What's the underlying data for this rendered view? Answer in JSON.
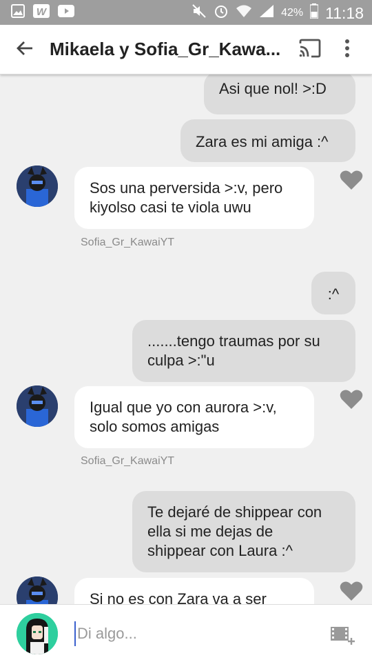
{
  "status_bar": {
    "battery_percent": "42%",
    "time": "11:18",
    "icons": [
      "gallery-icon",
      "w-app-icon",
      "youtube-icon",
      "mute-icon",
      "alarm-icon",
      "wifi-icon",
      "signal-icon",
      "battery-icon"
    ]
  },
  "app_bar": {
    "title": "Mikaela y Sofia_Gr_Kawa...",
    "back_icon": "arrow-back-icon",
    "cast_icon": "cast-icon",
    "more_icon": "more-vertical-icon"
  },
  "messages": [
    {
      "direction": "out",
      "text": "Asi que nol!  >:D"
    },
    {
      "direction": "out",
      "text": "Zara es mi amiga :^"
    },
    {
      "direction": "in",
      "text": "Sos una perversida >:v, pero\nkiyolso casi te viola uwu",
      "sender": "Sofia_Gr_KawaiYT"
    },
    {
      "direction": "out",
      "text": ":^"
    },
    {
      "direction": "out",
      "text": ".......tengo traumas por su\nculpa >:\"u"
    },
    {
      "direction": "in",
      "text": "Igual que yo con aurora  >:v,\nsolo somos amigas",
      "sender": "Sofia_Gr_KawaiYT"
    },
    {
      "direction": "out",
      "text": "Te dejaré de shippear con\nella si me dejas de\nshippear con Laura :^"
    },
    {
      "direction": "in",
      "text": "Si no es con Zara va a ser"
    }
  ],
  "composer": {
    "placeholder": "Di algo...",
    "media_icon": "add-video-icon"
  },
  "colors": {
    "status_bar": "#9e9e9e",
    "incoming_bubble": "#ffffff",
    "outgoing_bubble": "#dcdcdc",
    "background": "#f0f0f0",
    "heart": "#8c8c8c"
  }
}
